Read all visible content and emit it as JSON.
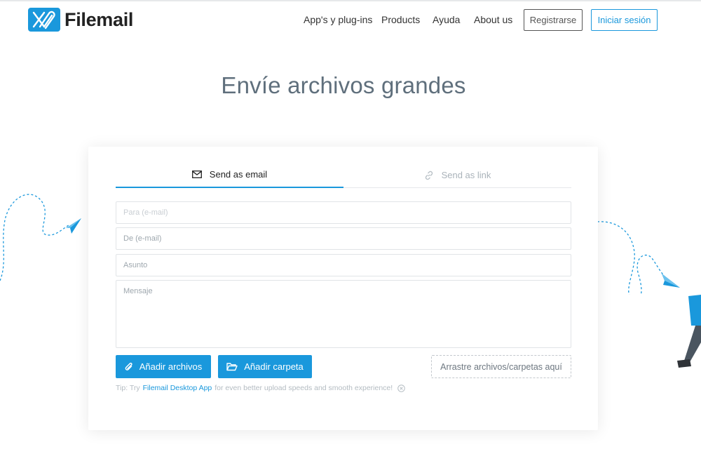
{
  "brand": {
    "name": "Filemail",
    "color": "#1a98dc"
  },
  "nav": {
    "items": [
      {
        "label": "App's y plug-ins"
      },
      {
        "label": "Products"
      },
      {
        "label": "Ayuda"
      },
      {
        "label": "About us"
      }
    ],
    "register_label": "Registrarse",
    "login_label": "Iniciar sesión"
  },
  "page": {
    "title": "Envíe archivos grandes"
  },
  "tabs": [
    {
      "label": "Send as email",
      "icon": "envelope-icon",
      "active": true
    },
    {
      "label": "Send as link",
      "icon": "link-icon",
      "active": false
    }
  ],
  "form": {
    "to_placeholder": "Para (e-mail)",
    "from_placeholder": "De (e-mail)",
    "subject_placeholder": "Asunto",
    "message_placeholder": "Mensaje",
    "add_files_label": "Añadir archivos",
    "add_folder_label": "Añadir carpeta",
    "dropzone_label": "Arrastre archivos/carpetas aquí"
  },
  "tip": {
    "prefix": "Tip: Try",
    "link": "Filemail Desktop App",
    "suffix": "for even better upload speeds and smooth experience!"
  }
}
